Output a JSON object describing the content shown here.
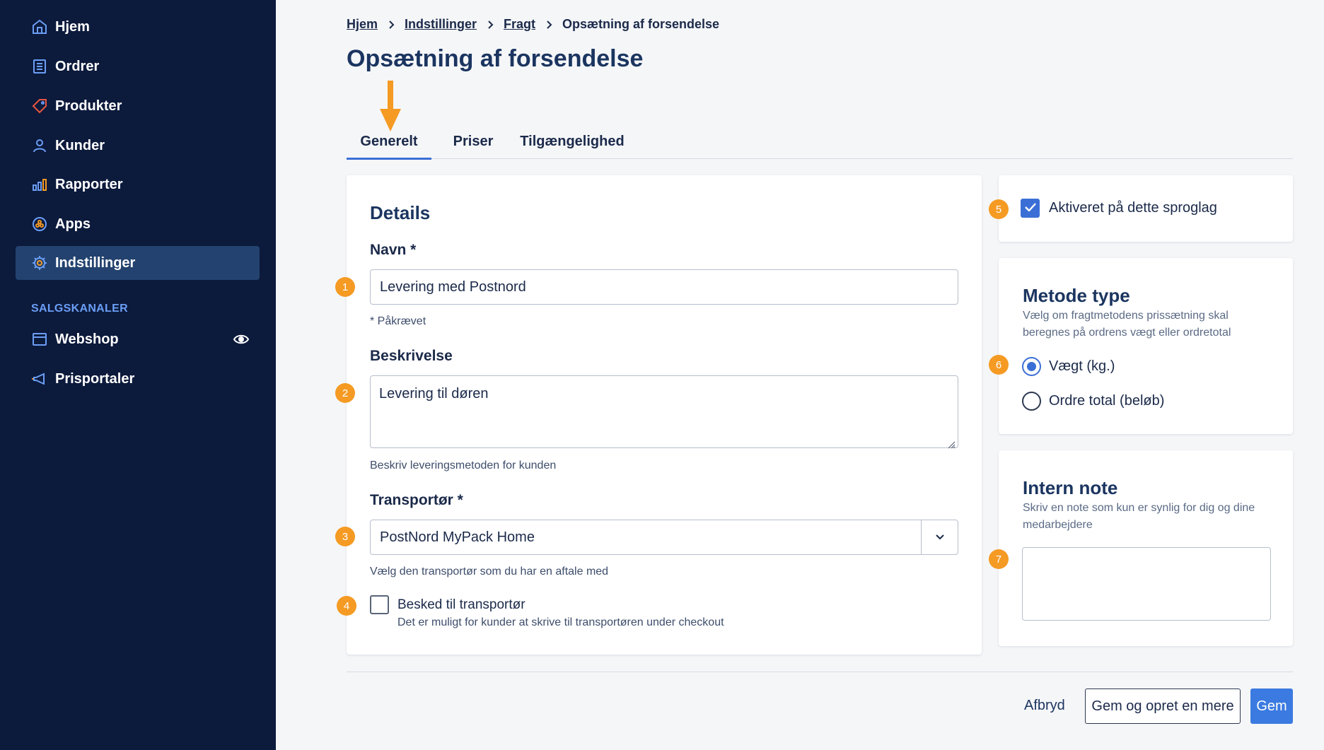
{
  "sidebar": {
    "items": [
      {
        "label": "Hjem",
        "icon": "home-icon"
      },
      {
        "label": "Ordrer",
        "icon": "orders-icon"
      },
      {
        "label": "Produkter",
        "icon": "tag-icon"
      },
      {
        "label": "Kunder",
        "icon": "user-icon"
      },
      {
        "label": "Rapporter",
        "icon": "bar-chart-icon"
      },
      {
        "label": "Apps",
        "icon": "apps-icon"
      },
      {
        "label": "Indstillinger",
        "icon": "gear-icon",
        "active": true
      }
    ],
    "section_label": "SALGSKANALER",
    "channels": [
      {
        "label": "Webshop",
        "icon": "store-icon"
      },
      {
        "label": "Prisportaler",
        "icon": "megaphone-icon"
      }
    ]
  },
  "breadcrumb": {
    "items": [
      "Hjem",
      "Indstillinger",
      "Fragt"
    ],
    "current": "Opsætning af forsendelse"
  },
  "page_title": "Opsætning af forsendelse",
  "tabs": [
    "Generelt",
    "Priser",
    "Tilgængelighed"
  ],
  "details": {
    "title": "Details",
    "name_label": "Navn *",
    "name_value": "Levering med Postnord",
    "name_help": "* Påkrævet",
    "description_label": "Beskrivelse",
    "description_value": "Levering til døren",
    "description_help": "Beskriv leveringsmetoden for kunden",
    "carrier_label": "Transportør *",
    "carrier_value": "PostNord MyPack Home",
    "carrier_help": "Vælg den transportør som du har en aftale med",
    "message_label": "Besked til transportør",
    "message_help": "Det er muligt for kunder at skrive til transportøren under checkout"
  },
  "language_card": {
    "label": "Aktiveret på dette sproglag"
  },
  "method_card": {
    "title": "Metode type",
    "desc": "Vælg om fragtmetodens prissætning skal beregnes på ordrens vægt eller ordretotal",
    "options": [
      "Vægt (kg.)",
      "Ordre total (beløb)"
    ]
  },
  "note_card": {
    "title": "Intern note",
    "desc": "Skriv en note som kun er synlig for dig og dine medarbejdere"
  },
  "badges": [
    "1",
    "2",
    "3",
    "4",
    "5",
    "6",
    "7"
  ],
  "actions": {
    "cancel": "Afbryd",
    "save_and_new": "Gem og opret en mere",
    "save": "Gem"
  },
  "colors": {
    "sidebar_bg": "#0c1a3c",
    "active_item": "#23426f",
    "accent": "#3b6fd6",
    "badge": "#f59a23",
    "icon_blue": "#6b9ef5"
  }
}
